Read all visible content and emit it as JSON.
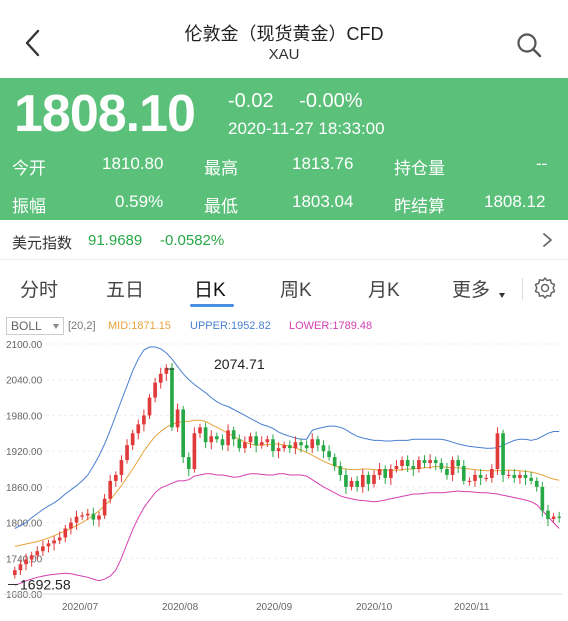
{
  "nav": {
    "title": "伦敦金（现货黄金）CFD",
    "subtitle": "XAU",
    "back_icon": "chevron-left-icon",
    "search_icon": "search-icon"
  },
  "quote": {
    "price": "1808.10",
    "change": "-0.02",
    "change_pct": "-0.00%",
    "time": "2020-11-27 18:33:00",
    "bg_color": "#5bc07a",
    "stats": [
      [
        {
          "label": "今开",
          "value": "1810.80"
        },
        {
          "label": "最高",
          "value": "1813.76"
        },
        {
          "label": "持仓量",
          "value": "--"
        }
      ],
      [
        {
          "label": "振幅",
          "value": "0.59%"
        },
        {
          "label": "最低",
          "value": "1803.04"
        },
        {
          "label": "昨结算",
          "value": "1808.12"
        }
      ]
    ]
  },
  "index": {
    "name": "美元指数",
    "value": "91.9689",
    "change": "-0.0582%",
    "color": "#27a845"
  },
  "tabs": {
    "items": [
      "分时",
      "五日",
      "日K",
      "周K",
      "月K",
      "更多"
    ],
    "active": "日K"
  },
  "indicator": {
    "name": "BOLL",
    "params": "[20,2]",
    "mid": "MID:1871.15",
    "upper": "UPPER:1952.82",
    "lower": "LOWER:1789.48",
    "colors": {
      "mid": "#e8a33b",
      "upper": "#4a7fd0",
      "lower": "#d63fb0"
    }
  },
  "chart_data": {
    "type": "candlestick",
    "y_ticks": [
      "2100.00",
      "2040.00",
      "1980.00",
      "1920.00",
      "1860.00",
      "1800.00",
      "1740.00",
      "1680.00"
    ],
    "ylim": [
      1680,
      2100
    ],
    "x_labels": [
      "2020/07",
      "2020/08",
      "2020/09",
      "2020/10",
      "2020/11"
    ],
    "high_marker": "2074.71",
    "low_marker": "1692.58",
    "up_color": "#e03a3a",
    "down_color": "#27a845",
    "close_series": [
      1720,
      1730,
      1738,
      1745,
      1752,
      1760,
      1765,
      1770,
      1775,
      1790,
      1800,
      1810,
      1812,
      1815,
      1805,
      1812,
      1840,
      1870,
      1880,
      1905,
      1930,
      1950,
      1965,
      1980,
      2010,
      2035,
      2050,
      2060,
      1960,
      1990,
      1910,
      1890,
      1950,
      1960,
      1935,
      1945,
      1940,
      1930,
      1955,
      1940,
      1925,
      1935,
      1945,
      1930,
      1935,
      1940,
      1920,
      1925,
      1930,
      1925,
      1935,
      1930,
      1925,
      1940,
      1930,
      1920,
      1910,
      1895,
      1880,
      1860,
      1870,
      1860,
      1880,
      1865,
      1880,
      1890,
      1875,
      1890,
      1895,
      1905,
      1895,
      1890,
      1905,
      1900,
      1905,
      1900,
      1890,
      1880,
      1905,
      1895,
      1870,
      1870,
      1880,
      1875,
      1875,
      1890,
      1950,
      1880,
      1880,
      1875,
      1880,
      1875,
      1870,
      1860,
      1820,
      1806,
      1810,
      1808
    ],
    "mid_series": [
      1760,
      1762,
      1764,
      1766,
      1768,
      1771,
      1774,
      1778,
      1782,
      1786,
      1790,
      1795,
      1800,
      1806,
      1812,
      1820,
      1828,
      1838,
      1850,
      1862,
      1876,
      1890,
      1905,
      1920,
      1933,
      1945,
      1953,
      1960,
      1965,
      1968,
      1970,
      1970,
      1972,
      1972,
      1970,
      1965,
      1960,
      1955,
      1950,
      1945,
      1940,
      1935,
      1932,
      1930,
      1930,
      1931,
      1932,
      1932,
      1930,
      1928,
      1925,
      1922,
      1918,
      1913,
      1908,
      1903,
      1899,
      1895,
      1892,
      1890,
      1889,
      1889,
      1890,
      1890,
      1889,
      1888,
      1888,
      1888,
      1888,
      1889,
      1890,
      1890,
      1891,
      1892,
      1893,
      1894,
      1894,
      1893,
      1892,
      1892,
      1891,
      1890,
      1889,
      1888,
      1887,
      1887,
      1887,
      1888,
      1888,
      1888,
      1887,
      1886,
      1885,
      1883,
      1880,
      1876,
      1873,
      1871
    ],
    "upper_series": [
      1790,
      1795,
      1800,
      1808,
      1815,
      1822,
      1828,
      1833,
      1840,
      1848,
      1855,
      1862,
      1870,
      1880,
      1895,
      1912,
      1932,
      1955,
      1980,
      2005,
      2030,
      2055,
      2075,
      2090,
      2095,
      2095,
      2092,
      2085,
      2075,
      2062,
      2050,
      2040,
      2032,
      2025,
      2018,
      2010,
      2003,
      1998,
      1995,
      1990,
      1985,
      1980,
      1975,
      1970,
      1965,
      1962,
      1958,
      1952,
      1948,
      1945,
      1942,
      1940,
      1940,
      1955,
      1958,
      1960,
      1962,
      1962,
      1960,
      1956,
      1950,
      1945,
      1942,
      1940,
      1938,
      1938,
      1937,
      1937,
      1938,
      1938,
      1938,
      1940,
      1940,
      1940,
      1940,
      1940,
      1940,
      1938,
      1935,
      1932,
      1930,
      1928,
      1927,
      1926,
      1925,
      1925,
      1926,
      1930,
      1934,
      1938,
      1940,
      1940,
      1938,
      1940,
      1945,
      1950,
      1953,
      1953
    ],
    "lower_series": [
      1695,
      1698,
      1702,
      1705,
      1708,
      1710,
      1712,
      1713,
      1714,
      1715,
      1714,
      1712,
      1710,
      1708,
      1705,
      1702,
      1705,
      1710,
      1720,
      1740,
      1765,
      1788,
      1808,
      1825,
      1838,
      1850,
      1858,
      1862,
      1866,
      1870,
      1870,
      1872,
      1878,
      1880,
      1882,
      1882,
      1880,
      1880,
      1878,
      1876,
      1877,
      1880,
      1882,
      1882,
      1881,
      1880,
      1880,
      1882,
      1882,
      1880,
      1880,
      1880,
      1878,
      1872,
      1866,
      1860,
      1855,
      1850,
      1845,
      1842,
      1840,
      1838,
      1837,
      1836,
      1835,
      1836,
      1838,
      1840,
      1842,
      1844,
      1846,
      1848,
      1848,
      1849,
      1850,
      1850,
      1850,
      1851,
      1852,
      1853,
      1852,
      1852,
      1851,
      1850,
      1850,
      1849,
      1848,
      1846,
      1844,
      1842,
      1840,
      1838,
      1835,
      1830,
      1820,
      1810,
      1800,
      1790
    ]
  }
}
